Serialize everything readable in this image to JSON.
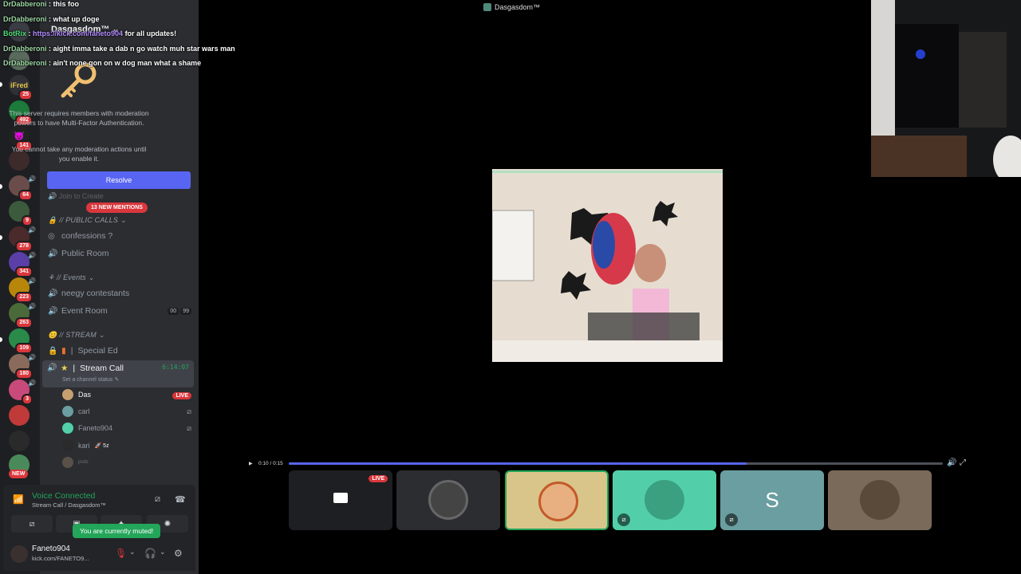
{
  "chat": [
    {
      "user": "DrDabberoni",
      "message": "this foo"
    },
    {
      "user": "DrDabberoni",
      "message": "what up doge"
    },
    {
      "user": "BotRix",
      "message_prefix": "https://kick.com/faneto904",
      "message": "for all updates!"
    },
    {
      "user": "DrDabberoni",
      "message": "aight imma take a dab n go watch muh star wars man"
    },
    {
      "user": "DrDabberoni",
      "message": "ain't none gon on w dog man what a shame"
    }
  ],
  "server": {
    "name": "Dasgasdom™"
  },
  "mfa": {
    "text1": "This server requires members with moderation powers to have Multi-Factor Authentication.",
    "text2": "You cannot take any moderation actions until you enable it.",
    "resolve_label": "Resolve"
  },
  "faded_channel": "Join to Create",
  "new_mentions": "13 NEW MENTIONS",
  "categories": {
    "public_calls": "// PUBLIC CALLS",
    "events": "// Events",
    "stream": "// STREAM"
  },
  "channels": {
    "confessions": "confessions ?",
    "public_room": "Public Room",
    "neegy": "neegy contestants",
    "event_room": "Event Room",
    "event_room_tags": [
      "00",
      "99"
    ],
    "special_ed": "Special Ed",
    "stream_call": "Stream Call",
    "stream_call_timer": "6:14:07",
    "channel_status": "Set a channel status"
  },
  "voice_users": [
    {
      "name": "Das",
      "status": "LIVE"
    },
    {
      "name": "carl",
      "status": ""
    },
    {
      "name": "Faneto904",
      "status": ""
    },
    {
      "name": "kari",
      "status": "🚀 5z"
    },
    {
      "name": "pvds",
      "status": ""
    }
  ],
  "server_rail": {
    "badges": [
      "25",
      "492",
      "141",
      "64",
      "9",
      "278",
      "341",
      "223",
      "263",
      "109",
      "180",
      "3"
    ],
    "new_label": "NEW"
  },
  "voice_panel": {
    "title": "Voice Connected",
    "subtitle": "Stream Call / Dasgasdom™",
    "tooltip": "You are currently muted!"
  },
  "user": {
    "name": "Faneto904",
    "status": "kick.com/FANETO9..."
  },
  "stage": {
    "title": "Dasgasdom™",
    "time": "0:10 / 0:15",
    "progress": 0.7,
    "live_label": "LIVE"
  },
  "tiles": [
    {
      "name": "screen-share",
      "bg": "#1e1f22",
      "live": true,
      "muted": false
    },
    {
      "name": "user-dark",
      "bg": "#2b2d31",
      "live": false,
      "muted": false
    },
    {
      "name": "user-aang",
      "bg": "#d9c58a",
      "live": false,
      "muted": false
    },
    {
      "name": "user-runner",
      "bg": "#52cfa8",
      "live": false,
      "muted": true
    },
    {
      "name": "user-s",
      "bg": "#6a9ea0",
      "live": false,
      "muted": true,
      "letter": "S"
    },
    {
      "name": "user-photo",
      "bg": "#7a6a5a",
      "live": false,
      "muted": false
    }
  ],
  "colors": {
    "accent": "#5865f2",
    "danger": "#da373c",
    "online": "#23a55a"
  }
}
